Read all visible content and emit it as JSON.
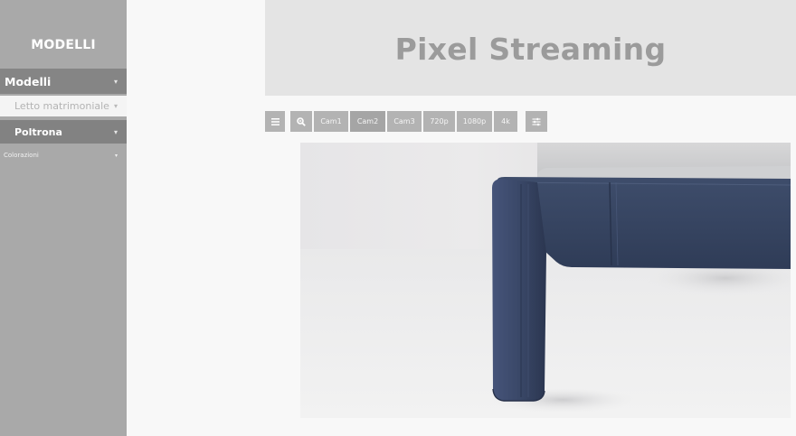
{
  "sidebar": {
    "title": "MODELLI",
    "items": [
      {
        "label": "Modelli",
        "caret": "▾"
      },
      {
        "label": "Letto matrimoniale",
        "caret": "▾"
      },
      {
        "label": "Poltrona",
        "caret": "▾"
      },
      {
        "label": "Colorazioni",
        "caret": "▾"
      }
    ]
  },
  "header": {
    "title": "Pixel Streaming"
  },
  "toolbar": {
    "menu_icon": "menu-icon",
    "zoom_icon": "zoom-icon",
    "settings_icon": "sliders-icon",
    "buttons": [
      "Cam1",
      "Cam2",
      "Cam3",
      "720p",
      "1080p",
      "4k"
    ],
    "active": "Cam2"
  },
  "video": {
    "content": "armchair-leg-render"
  },
  "colors": {
    "sidebar": "#a9a9a9",
    "sidebar_active": "#858585",
    "header_bg": "#e4e4e4",
    "header_text": "#9b9b9b",
    "button": "#b3b3b3",
    "upholstery": "#394866"
  }
}
